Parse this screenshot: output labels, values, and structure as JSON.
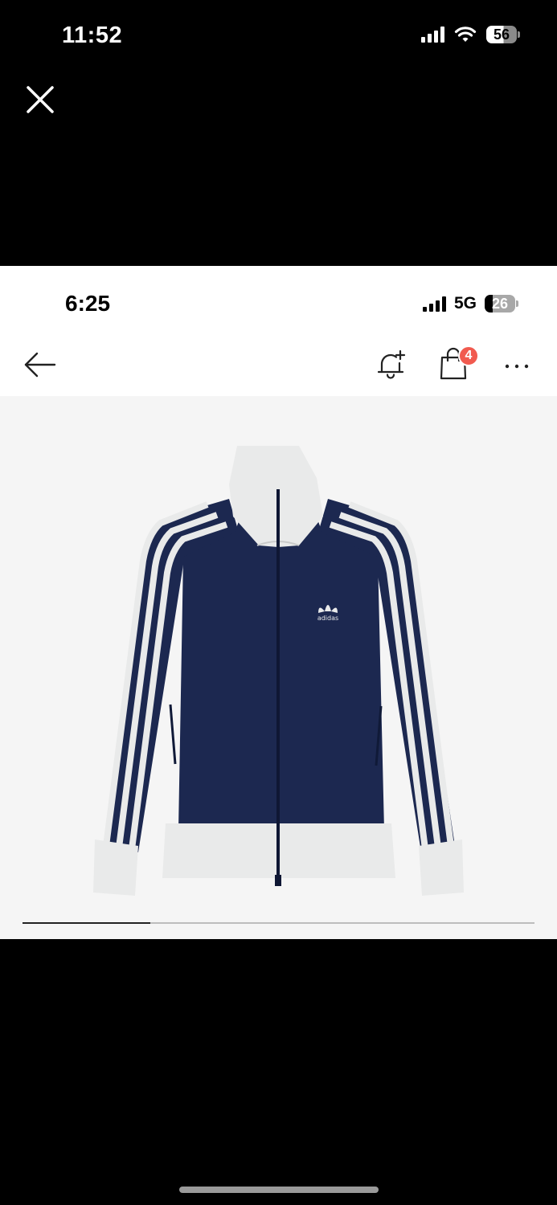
{
  "outer_status": {
    "time": "11:52",
    "battery": "56",
    "icons": [
      "cellular-signal-icon",
      "wifi-icon",
      "battery-icon"
    ]
  },
  "viewer": {
    "close_icon": "close-icon"
  },
  "inner_screen": {
    "status": {
      "time": "6:25",
      "network": "5G",
      "battery": "26"
    },
    "nav": {
      "back_icon": "arrow-left-icon",
      "notify_icon": "bell-plus-icon",
      "cart_icon": "shopping-bag-icon",
      "cart_badge": "4",
      "more_icon": "more-horizontal-icon"
    },
    "product": {
      "image": "navy track jacket with white stripes",
      "logo_text": "adidas",
      "gallery_progress": 0.25
    }
  },
  "colors": {
    "jacket_navy": "#1c2850",
    "jacket_white": "#e9eaea",
    "badge_red": "#f15a4f",
    "product_bg": "#f5f5f5"
  }
}
